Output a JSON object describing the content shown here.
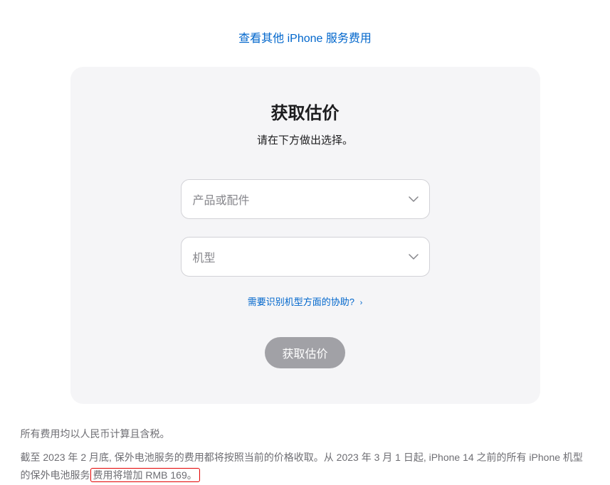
{
  "topLink": {
    "text": "查看其他 iPhone 服务费用"
  },
  "card": {
    "title": "获取估价",
    "subtitle": "请在下方做出选择。",
    "productSelect": {
      "placeholder": "产品或配件"
    },
    "modelSelect": {
      "placeholder": "机型"
    },
    "helpLink": {
      "text": "需要识别机型方面的协助?"
    },
    "submitButton": {
      "label": "获取估价"
    }
  },
  "footer": {
    "line1": "所有费用均以人民币计算且含税。",
    "line2_part1": "截至 2023 年 2 月底, 保外电池服务的费用都将按照当前的价格收取。从 2023 年 3 月 1 日起, iPhone 14 之前的所有 iPhone 机型的保外电池服务",
    "line2_highlight": "费用将增加 RMB 169。"
  }
}
